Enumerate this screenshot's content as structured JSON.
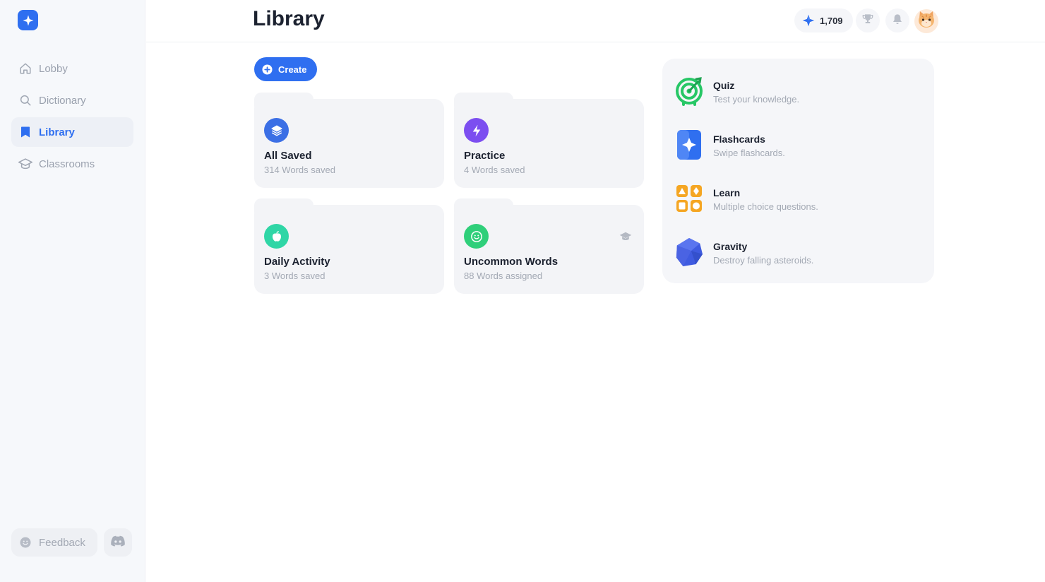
{
  "app": {
    "logo_icon": "sparkle-logo-icon",
    "accent": "#2f6ff0"
  },
  "sidebar": {
    "items": [
      {
        "label": "Lobby",
        "icon": "home-icon"
      },
      {
        "label": "Dictionary",
        "icon": "search-icon"
      },
      {
        "label": "Library",
        "icon": "bookmark-icon",
        "active": true
      },
      {
        "label": "Classrooms",
        "icon": "graduation-cap-icon"
      }
    ],
    "feedback_label": "Feedback",
    "discord_icon": "discord-icon"
  },
  "header": {
    "title": "Library",
    "gems": "1,709",
    "trophy_icon": "trophy-icon",
    "bell_icon": "bell-icon",
    "avatar_icon": "cat-avatar-icon"
  },
  "create_label": "Create",
  "folders": [
    {
      "name": "All Saved",
      "sub": "314 Words saved",
      "icon": "stack-icon",
      "color": "#3b6fe5"
    },
    {
      "name": "Practice",
      "sub": "4 Words saved",
      "icon": "lightning-icon",
      "color": "#7c4ef0"
    },
    {
      "name": "Daily Activity",
      "sub": "3 Words saved",
      "icon": "apple-icon",
      "color": "#2fd6a6"
    },
    {
      "name": "Uncommon Words",
      "sub": "88 Words assigned",
      "icon": "smiley-icon",
      "color": "#2fcf7a",
      "badge": "graduation-cap-icon"
    }
  ],
  "games": [
    {
      "name": "Quiz",
      "sub": "Test your knowledge.",
      "icon": "target-icon"
    },
    {
      "name": "Flashcards",
      "sub": "Swipe flashcards.",
      "icon": "flashcard-icon"
    },
    {
      "name": "Learn",
      "sub": "Multiple choice questions.",
      "icon": "shapes-grid-icon"
    },
    {
      "name": "Gravity",
      "sub": "Destroy falling asteroids.",
      "icon": "asteroid-icon"
    }
  ]
}
